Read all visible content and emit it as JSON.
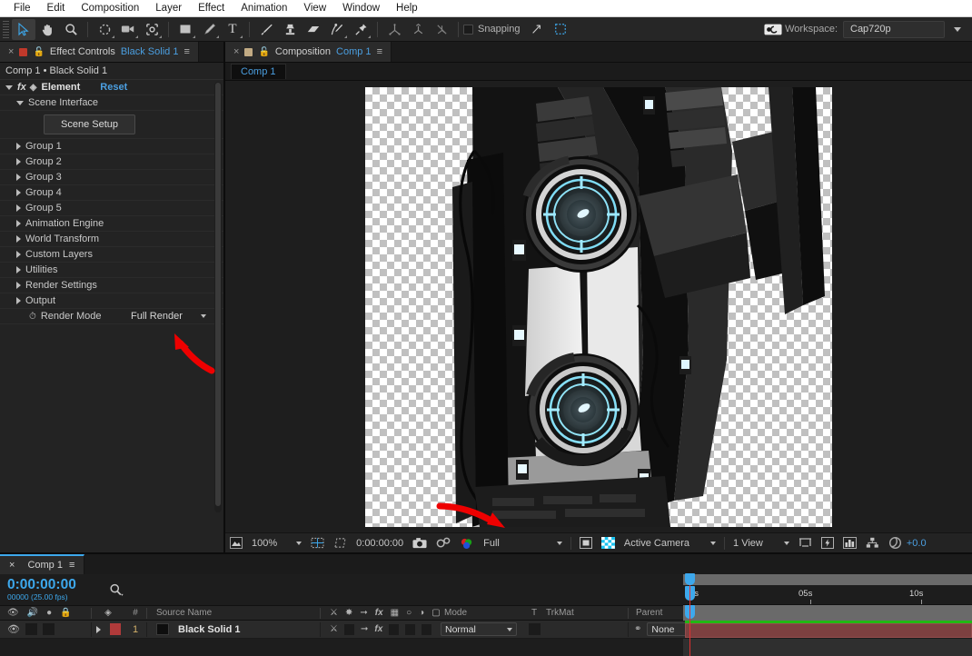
{
  "menubar": {
    "items": [
      "File",
      "Edit",
      "Composition",
      "Layer",
      "Effect",
      "Animation",
      "View",
      "Window",
      "Help"
    ]
  },
  "toolbar": {
    "tools": [
      {
        "name": "selection-tool",
        "glyph": "➤",
        "selected": true
      },
      {
        "name": "hand-tool",
        "glyph": "✋",
        "selected": false
      },
      {
        "name": "zoom-tool",
        "glyph": "🔍",
        "selected": false
      },
      {
        "name": "rotation-tool",
        "glyph": "↺",
        "selected": false
      },
      {
        "name": "camera-tool",
        "glyph": "🎥",
        "selected": false
      },
      {
        "name": "pan-behind-tool",
        "glyph": "✥",
        "selected": false
      },
      {
        "name": "shape-tool",
        "glyph": "■",
        "selected": false
      },
      {
        "name": "pen-tool",
        "glyph": "✒",
        "selected": false
      },
      {
        "name": "type-tool",
        "glyph": "T",
        "selected": false
      },
      {
        "name": "brush-tool",
        "glyph": "╱",
        "selected": false
      },
      {
        "name": "clone-stamp-tool",
        "glyph": "⚓",
        "selected": false
      },
      {
        "name": "eraser-tool",
        "glyph": "▱",
        "selected": false
      },
      {
        "name": "roto-brush-tool",
        "glyph": "✨",
        "selected": false
      },
      {
        "name": "puppet-pin-tool",
        "glyph": "📌",
        "selected": false
      }
    ],
    "axis_tools": [
      {
        "name": "local-axis-mode-icon"
      },
      {
        "name": "world-axis-mode-icon"
      },
      {
        "name": "view-axis-mode-icon"
      }
    ],
    "snapping_label": "Snapping",
    "snapping_checked": false,
    "workspace_label": "Workspace:",
    "workspace_value": "Cap720p"
  },
  "effect_controls": {
    "tab_title": "Effect Controls",
    "tab_subject": "Black Solid 1",
    "breadcrumb": "Comp 1 • Black Solid 1",
    "effect_name": "Element",
    "reset_label": "Reset",
    "section_label": "Scene Interface",
    "scene_setup_label": "Scene Setup",
    "groups": [
      "Group 1",
      "Group 2",
      "Group 3",
      "Group 4",
      "Group 5",
      "Animation Engine",
      "World Transform",
      "Custom Layers",
      "Utilities",
      "Render Settings",
      "Output"
    ],
    "render_mode_label": "Render Mode",
    "render_mode_value": "Full Render"
  },
  "composition": {
    "tab_title": "Composition",
    "tab_subject": "Comp 1",
    "viewer_tab": "Comp 1",
    "bottom_bar": {
      "magnification": "100%",
      "timecode": "0:00:00:00",
      "resolution": "Full",
      "camera": "Active Camera",
      "views": "1 View",
      "exposure": "+0.0"
    }
  },
  "timeline": {
    "tab_title": "Comp 1",
    "current_time": "0:00:00:00",
    "frame_info": "00000 (25.00 fps)",
    "columns": {
      "index": "#",
      "source_name": "Source Name",
      "mode": "Mode",
      "t": "T",
      "trkmat": "TrkMat",
      "parent": "Parent"
    },
    "ruler_ticks": [
      "0s",
      "05s",
      "10s"
    ],
    "layers": [
      {
        "index": "1",
        "source_name": "Black Solid 1",
        "mode": "Normal",
        "parent": "None",
        "label_color": "#b03a3a",
        "solid_color": "#0b0b0b"
      }
    ]
  },
  "colors": {
    "accent_blue": "#4b9fe1",
    "annotation_red": "#ee0000",
    "work_area_green": "#22b714",
    "layer_bar": "#7d4040",
    "panel_bg": "#232323"
  },
  "annotations": [
    {
      "name": "arrow-to-render-mode",
      "note": ""
    },
    {
      "name": "arrow-to-viewer-model",
      "note": ""
    }
  ]
}
